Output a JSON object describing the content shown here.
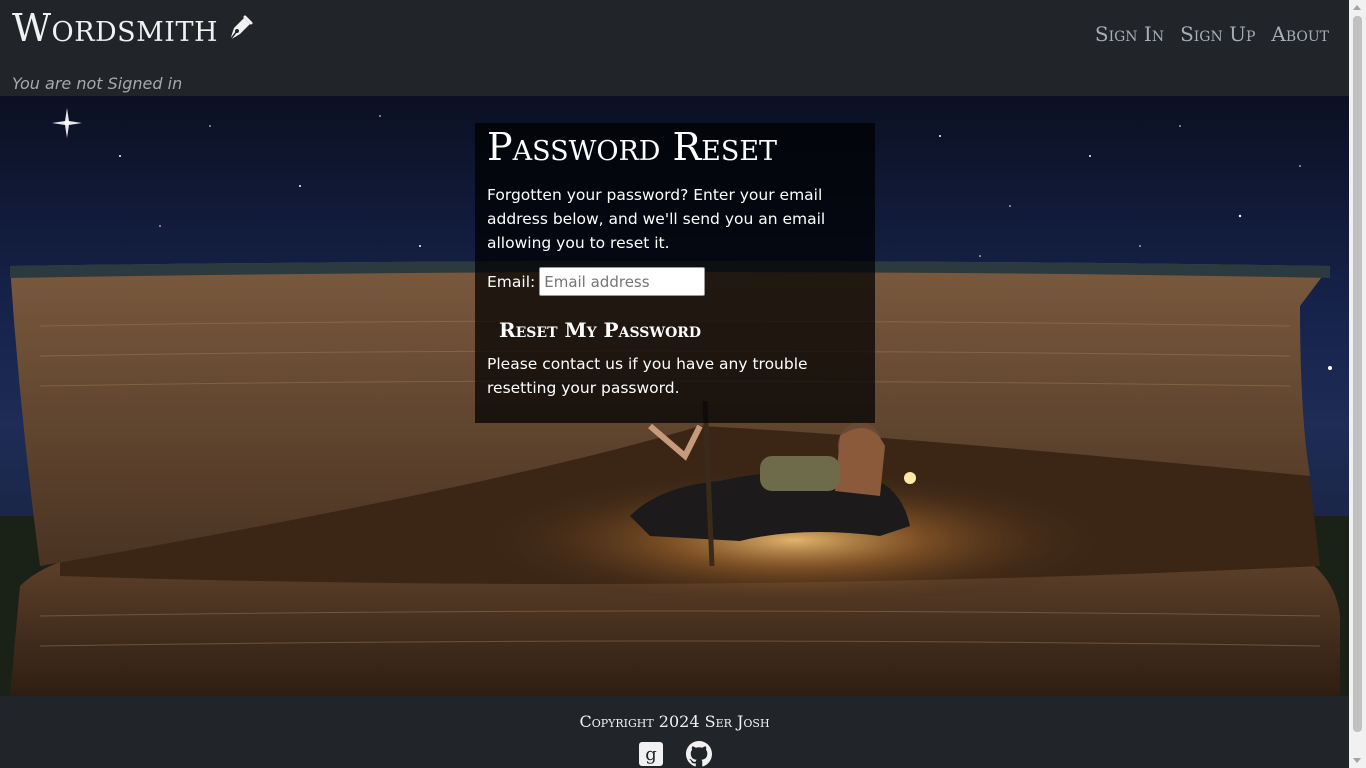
{
  "header": {
    "brand": "Wordsmith",
    "brand_icon": "pen-nib-icon",
    "nav": [
      {
        "label": "Sign In"
      },
      {
        "label": "Sign Up"
      },
      {
        "label": "About"
      }
    ],
    "signed_status": "You are not Signed in"
  },
  "hero": {
    "image": "girl-reading-inside-giant-book"
  },
  "panel": {
    "title": "Password Reset",
    "intro": "Forgotten your password? Enter your email address below, and we'll send you an email allowing you to reset it.",
    "email_label": "Email:",
    "email_placeholder": "Email address",
    "email_value": "",
    "submit_label": "Reset My Password",
    "help_text": "Please contact us if you have any trouble resetting your password."
  },
  "footer": {
    "copyright": "Copyright 2024 Ser Josh",
    "icons": [
      "goodreads-icon",
      "github-icon"
    ]
  },
  "colors": {
    "header_bg": "#212529",
    "nav_link": "#a8adb3",
    "panel_bg": "rgba(0,0,0,0.72)",
    "text_light": "#f1f1f1"
  }
}
